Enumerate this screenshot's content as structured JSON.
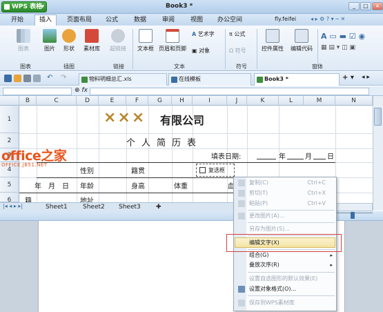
{
  "app": {
    "brand": "WPS 表格",
    "doc_title": "Book3 *",
    "user": "fly.feifei",
    "window_controls": [
      "_",
      "□",
      "×"
    ]
  },
  "menu": [
    "开始",
    "插入",
    "页面布局",
    "公式",
    "数据",
    "审阅",
    "视图",
    "办公空间"
  ],
  "ribbon": {
    "buttons": [
      "图表",
      "图片",
      "形状",
      "素材库",
      "超链接",
      "文本框",
      "页眉和页脚",
      "艺术字",
      "对象",
      "公式",
      "符号",
      "控件属性",
      "编辑代码"
    ],
    "groups": [
      "图表",
      "插图",
      "链接",
      "文本",
      "符号",
      "窗体"
    ]
  },
  "tabs": [
    {
      "label": "物料明细总汇.xls"
    },
    {
      "label": "在线模板"
    },
    {
      "label": "Book3 *"
    }
  ],
  "columns": [
    "B",
    "C",
    "D",
    "E",
    "F",
    "G",
    "H",
    "I",
    "J",
    "K",
    "L",
    "M",
    "N"
  ],
  "rows": [
    "1",
    "2",
    "3",
    "4",
    "5",
    "6"
  ],
  "sheet": {
    "title_prefix": "×××",
    "title_rest": "有限公司",
    "subtitle": "个人简历表",
    "fill_date": "填表日期:",
    "year": "年",
    "month": "月",
    "day": "日",
    "gender": "性别",
    "native": "籍贯",
    "checkbox": "复选框",
    "ymd": "年　月　日",
    "age": "年龄",
    "height": "身高",
    "weight": "体重",
    "blood": "血",
    "row6_a": "籍",
    "row6_b": "地址"
  },
  "sheet_tabs": [
    "Sheet1",
    "Sheet2",
    "Sheet3"
  ],
  "watermark": {
    "main": "office之家",
    "sub": "OFFICE.JB51.NET"
  },
  "context_menu": [
    {
      "label": "复制(C)",
      "shortcut": "Ctrl+C",
      "disabled": true
    },
    {
      "label": "剪切(T)",
      "shortcut": "Ctrl+X",
      "disabled": true
    },
    {
      "label": "粘贴(P)",
      "shortcut": "Ctrl+V",
      "disabled": true
    },
    {
      "label": "更改图片(A)...",
      "shortcut": "",
      "disabled": true
    },
    {
      "label": "另存为图片(S)...",
      "shortcut": "",
      "disabled": true
    },
    {
      "label": "编辑文字(X)",
      "shortcut": "",
      "disabled": false,
      "highlighted": true
    },
    {
      "label": "组合(G)",
      "shortcut": "",
      "disabled": false,
      "submenu": true
    },
    {
      "label": "叠放次序(R)",
      "shortcut": "",
      "disabled": false,
      "submenu": true
    },
    {
      "label": "设置自选图形的默认效果(E)",
      "shortcut": "",
      "disabled": true
    },
    {
      "label": "设置对象格式(O)...",
      "shortcut": "",
      "disabled": false
    },
    {
      "label": "保存到WPS素材库",
      "shortcut": "",
      "disabled": true
    }
  ],
  "colors": {
    "accent_red": "#d04040",
    "title_gold": "#b8862b",
    "logo_orange": "#e8541a"
  }
}
